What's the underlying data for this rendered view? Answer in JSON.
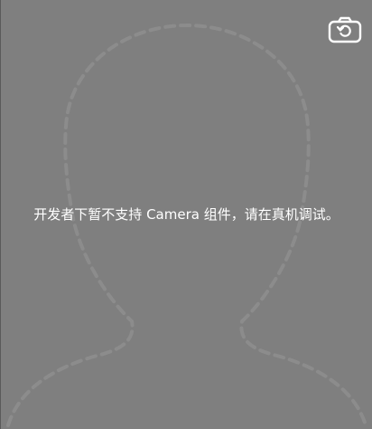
{
  "camera": {
    "message": "开发者下暂不支持 Camera 组件，请在真机调试。",
    "switch_icon": "camera-switch-icon",
    "guide_icon": "face-outline-guide-icon",
    "background_color": "#7f7f7f",
    "guide_color": "#8c8c8c"
  }
}
